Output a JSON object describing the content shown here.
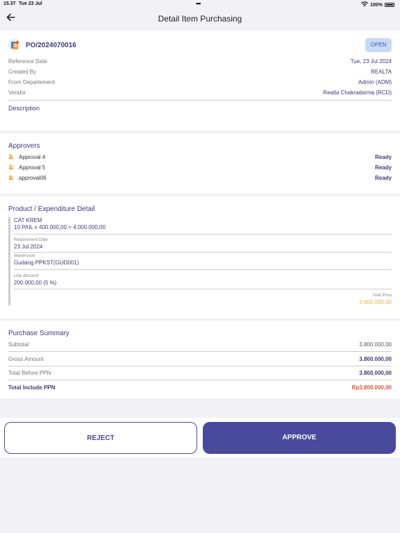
{
  "status_bar": {
    "time": "15.37",
    "date": "Tue 23 Jul",
    "battery": "100%"
  },
  "nav": {
    "title": "Detail Item Purchasing"
  },
  "po": {
    "number": "PO/2024070016",
    "status": "OPEN",
    "fields": [
      {
        "label": "Reference Date",
        "value": "Tue, 23 Jul 2024"
      },
      {
        "label": "Created By",
        "value": "REALTA"
      },
      {
        "label": "From Departement",
        "value": "Admin (ADM)"
      },
      {
        "label": "Vendor",
        "value": "Realta Chakradarma (RCD)"
      }
    ],
    "description_label": "Description"
  },
  "approvers": {
    "title": "Approvers",
    "items": [
      {
        "name": "Approval 4",
        "status": "Ready"
      },
      {
        "name": "Approval 5",
        "status": "Ready"
      },
      {
        "name": "approval06",
        "status": "Ready"
      }
    ]
  },
  "product": {
    "title": "Product / Expenditure Detail",
    "item_name": "CAT KREM",
    "item_calc": "10 PAIL x 400.000,00  = 4.000.000,00",
    "req_date_label": "Requirement Date",
    "req_date": "23 Jul 2024",
    "warehouse_label": "Warehouse",
    "warehouse": "Gudang PPKST(GUD001)",
    "discount_label": "Line discount",
    "discount": "200.000,00  (5 %)",
    "total_label": "Total Price",
    "total": "3.800.000,00"
  },
  "summary": {
    "title": "Purchase Summary",
    "rows": [
      {
        "label": "Subtotal",
        "value": "3.800.000,00"
      },
      {
        "label": "Gross Amount",
        "value": "3.800.000,00"
      },
      {
        "label": "Total Before PPN",
        "value": "3.800.000,00"
      },
      {
        "label": "Total Include PPN",
        "value": "Rp3.800.000,00"
      }
    ]
  },
  "actions": {
    "reject": "REJECT",
    "approve": "APPROVE"
  },
  "colors": {
    "accent": "#4a4a9c",
    "badge_bg": "#c9d9f5",
    "total_price": "#e8b84a",
    "total_ppn": "#e0533d"
  },
  "icons": [
    "back-arrow-icon",
    "wifi-icon",
    "battery-icon",
    "document-icon",
    "approver-icon"
  ]
}
